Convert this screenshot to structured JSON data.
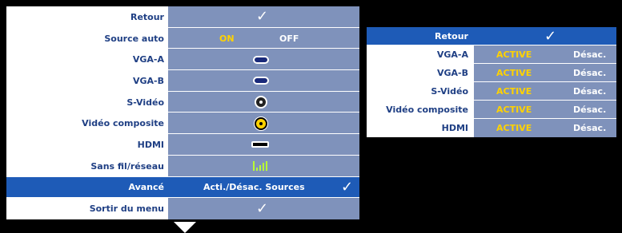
{
  "menu": {
    "retour": {
      "label": "Retour",
      "value": "✓"
    },
    "source_auto": {
      "label": "Source auto",
      "on": "ON",
      "off": "OFF"
    },
    "vga_a": {
      "label": "VGA-A"
    },
    "vga_b": {
      "label": "VGA-B"
    },
    "svideo": {
      "label": "S-Vidéo"
    },
    "composite": {
      "label": "Vidéo composite"
    },
    "hdmi": {
      "label": "HDMI"
    },
    "wireless": {
      "label": "Sans fil/réseau"
    },
    "advanced": {
      "label": "Avancé",
      "value": "Acti./Désac. Sources",
      "check": "✓"
    },
    "exit": {
      "label": "Sortir du menu",
      "value": "✓"
    }
  },
  "submenu": {
    "retour": {
      "label": "Retour",
      "value": "✓"
    },
    "rows": [
      {
        "label": "VGA-A",
        "active": "ACTIVE",
        "off": "Désac."
      },
      {
        "label": "VGA-B",
        "active": "ACTIVE",
        "off": "Désac."
      },
      {
        "label": "S-Vidéo",
        "active": "ACTIVE",
        "off": "Désac."
      },
      {
        "label": "Vidéo composite",
        "active": "ACTIVE",
        "off": "Désac."
      },
      {
        "label": "HDMI",
        "active": "ACTIVE",
        "off": "Désac."
      }
    ]
  },
  "icons": {
    "vga_a": "vga-connector-icon",
    "vga_b": "vga-connector-icon",
    "svideo": "svideo-connector-icon",
    "composite": "rca-connector-icon",
    "hdmi": "hdmi-connector-icon",
    "wireless": "wireless-signal-icon"
  },
  "colors": {
    "panel": "#7f92bb",
    "highlight": "#1e5bb7",
    "label_text": "#1f3f84",
    "on_text": "#ffd200"
  }
}
